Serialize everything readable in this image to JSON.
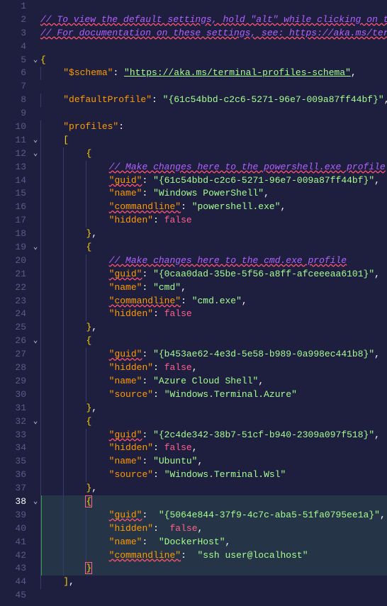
{
  "lineCount": 45,
  "activeLine": 38,
  "foldMarkers": {
    "5": "v",
    "11": "v",
    "12": "v",
    "19": "v",
    "26": "v",
    "32": "v",
    "38": "v"
  },
  "gitChangedLines": [
    38,
    39,
    40,
    41,
    42,
    43
  ],
  "comments": {
    "c1": "// To view the default settings, hold \"alt\" while clicking on the",
    "c2": "// For documentation on these settings, see: https://aka.ms/termin",
    "c13": "// Make changes here to the powershell.exe profile",
    "c20": "// Make changes here to the cmd.exe profile"
  },
  "keys": {
    "schema": "\"$schema\"",
    "defaultProfile": "\"defaultProfile\"",
    "profiles": "\"profiles\"",
    "guid": "\"guid\"",
    "name": "\"name\"",
    "commandline": "\"commandline\"",
    "hidden": "\"hidden\"",
    "source": "\"source\""
  },
  "values": {
    "schemaUrl": "\"https://aka.ms/terminal-profiles-schema\"",
    "defaultProfile": "\"{61c54bbd-c2c6-5271-96e7-009a87ff44bf}\"",
    "p1_guid": "\"{61c54bbd-c2c6-5271-96e7-009a87ff44bf}\"",
    "p1_name": "\"Windows PowerShell\"",
    "p1_cmd": "\"powershell.exe\"",
    "p2_guid": "\"{0caa0dad-35be-5f56-a8ff-afceeeaa6101}\"",
    "p2_name": "\"cmd\"",
    "p2_cmd": "\"cmd.exe\"",
    "p3_guid": "\"{b453ae62-4e3d-5e58-b989-0a998ec441b8}\"",
    "p3_name": "\"Azure Cloud Shell\"",
    "p3_src": "\"Windows.Terminal.Azure\"",
    "p4_guid": "\"{2c4de342-38b7-51cf-b940-2309a097f518}\"",
    "p4_name": "\"Ubuntu\"",
    "p4_src": "\"Windows.Terminal.Wsl\"",
    "p5_guid": "\"{5064e844-37f9-4c7c-aba5-51fa0795ee1a}\"",
    "p5_name": "\"DockerHost\"",
    "p5_cmd": "\"ssh user@localhost\""
  },
  "bools": {
    "false": "false"
  }
}
